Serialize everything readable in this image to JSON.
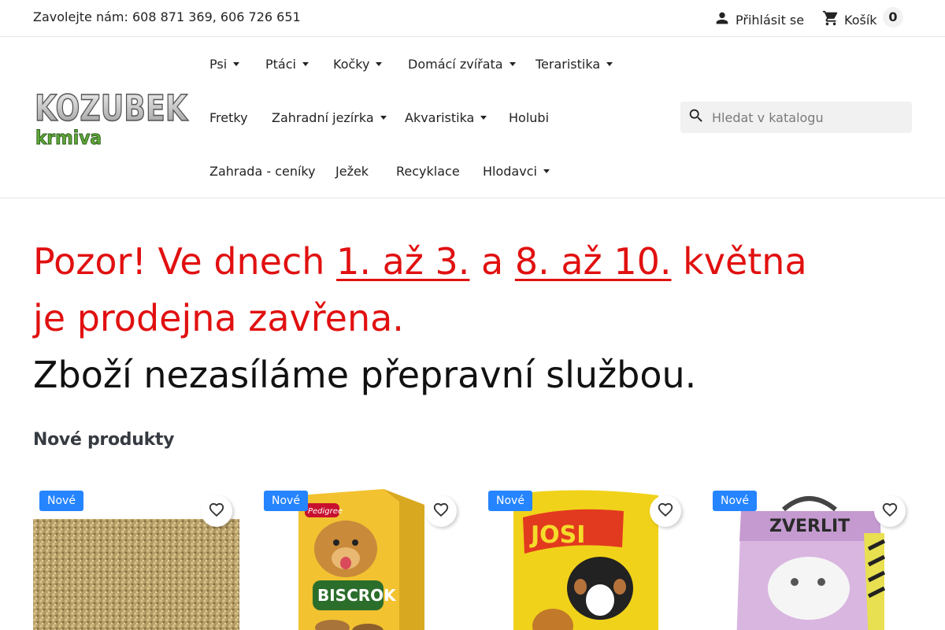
{
  "topbar": {
    "phone_text": "Zavolejte nám: 608 871 369, 606 726 651",
    "login_label": "Přihlásit se",
    "cart_label": "Košík",
    "cart_count": "0"
  },
  "logo": {
    "line1": "KOZUBEK",
    "line2": "krmiva"
  },
  "nav": {
    "items": [
      {
        "label": "Psi",
        "has_dropdown": true
      },
      {
        "label": "Ptáci",
        "has_dropdown": true
      },
      {
        "label": "Kočky",
        "has_dropdown": true
      },
      {
        "label": "Domácí zvířata",
        "has_dropdown": true
      },
      {
        "label": "Teraristika",
        "has_dropdown": true
      },
      {
        "label": "Fretky",
        "has_dropdown": false
      },
      {
        "label": "Zahradní jezírka",
        "has_dropdown": true
      },
      {
        "label": "Akvaristika",
        "has_dropdown": true
      },
      {
        "label": "Holubi",
        "has_dropdown": false
      },
      {
        "label": "Zahrada - ceníky",
        "has_dropdown": false
      },
      {
        "label": "Ježek",
        "has_dropdown": false
      },
      {
        "label": "Recyklace",
        "has_dropdown": false
      },
      {
        "label": "Hlodavci",
        "has_dropdown": true
      }
    ]
  },
  "search": {
    "placeholder": "Hledat v katalogu",
    "value": ""
  },
  "notice": {
    "l1_a": "Pozor! Ve dnech ",
    "l1_date1": "1. až 3.",
    "l1_b": " a ",
    "l1_date2": "8. až 10.",
    "l1_c": " května",
    "l2": "je prodejna zavřena.",
    "l3": "Zboží nezasíláme přepravní službou."
  },
  "section_title": "Nové produkty",
  "products": [
    {
      "badge": "Nové",
      "image": "grain-mix"
    },
    {
      "badge": "Nové",
      "image": "pedigree-biscrok-box",
      "brand_text": "Pedigree",
      "name_text": "BISCROK"
    },
    {
      "badge": "Nové",
      "image": "josidog-bag",
      "brand_text": "JOSI"
    },
    {
      "badge": "Nové",
      "image": "zverlit-litter-bag",
      "brand_text": "ZVERLIT"
    }
  ],
  "colors": {
    "notice_red": "#e11010",
    "badge_blue": "#2584ff",
    "logo_green": "#5fa83a"
  }
}
